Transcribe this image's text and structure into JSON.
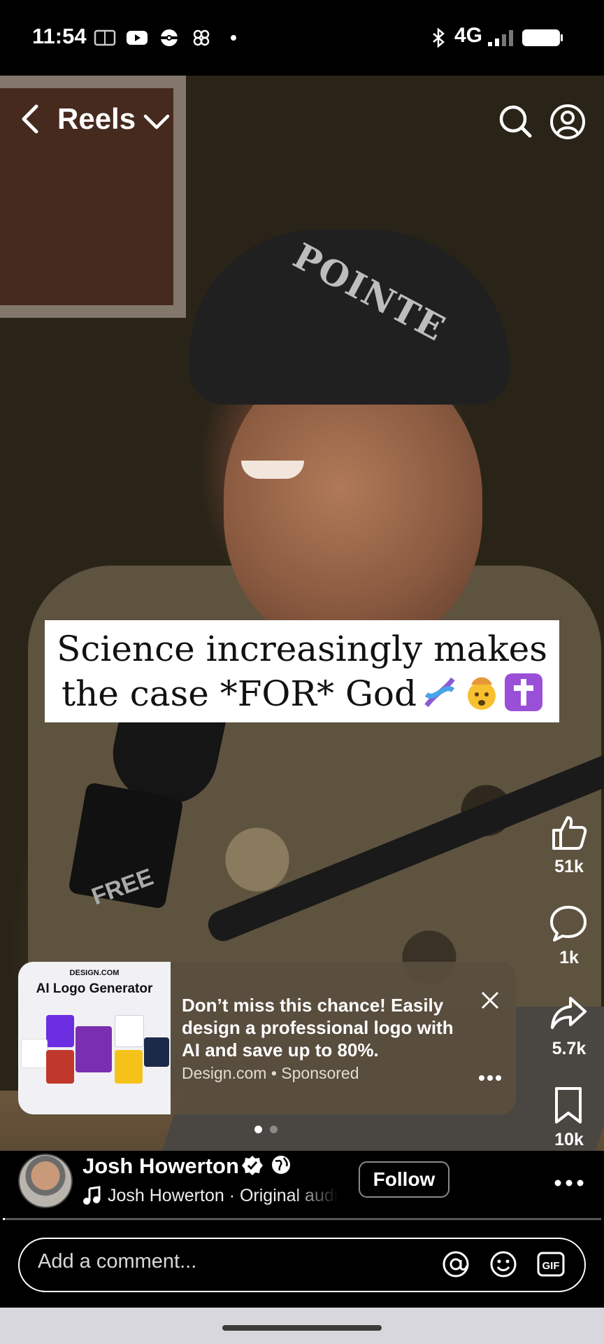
{
  "status_bar": {
    "time": "11:54",
    "network": "4G",
    "icons": [
      "book-icon",
      "youtube-icon",
      "pokeball-icon",
      "fan-icon",
      "dot-icon",
      "bluetooth-icon",
      "signal-icon",
      "battery-icon"
    ]
  },
  "header": {
    "title": "Reels"
  },
  "video": {
    "caption_line1": "Science increasingly makes",
    "caption_line2": "the case *FOR* God",
    "cap_text": "POINTE",
    "mic_text": "FREE"
  },
  "actions": {
    "likes": "51k",
    "comments": "1k",
    "shares": "5.7k",
    "saves": "10k"
  },
  "ad": {
    "brand": "DESIGN.COM",
    "thumb_title": "AI Logo Generator",
    "text": "Don’t miss this chance! Easily design a professional logo with AI and save up to 80%.",
    "source": "Design.com • Sponsored"
  },
  "carousel": {
    "count": 2,
    "active": 0
  },
  "author": {
    "name": "Josh Howerton",
    "audio": "Josh Howerton · Original audio",
    "follow_label": "Follow"
  },
  "progress": {
    "fraction": 0.004
  },
  "comment": {
    "placeholder": "Add a comment..."
  },
  "colors": {
    "background": "#000000",
    "nav_bar": "#d7d7dd",
    "ad_card": "#5a4e3e"
  }
}
